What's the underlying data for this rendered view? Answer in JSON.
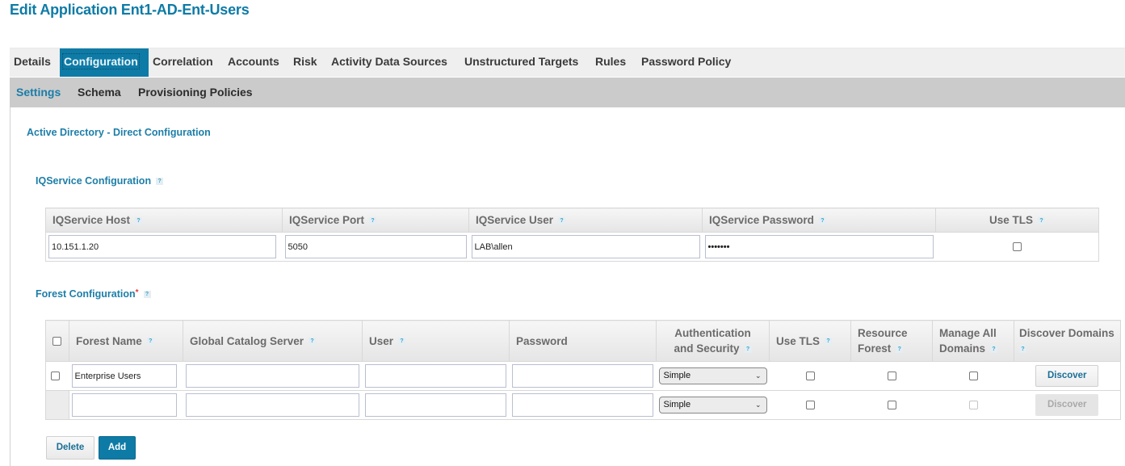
{
  "page": {
    "title": "Edit Application Ent1-AD-Ent-Users"
  },
  "tabs": [
    {
      "label": "Details",
      "active": false
    },
    {
      "label": "Configuration",
      "active": true
    },
    {
      "label": "Correlation",
      "active": false
    },
    {
      "label": "Accounts",
      "active": false
    },
    {
      "label": "Risk",
      "active": false
    },
    {
      "label": "Activity Data Sources",
      "active": false
    },
    {
      "label": "Unstructured Targets",
      "active": false
    },
    {
      "label": "Rules",
      "active": false
    },
    {
      "label": "Password Policy",
      "active": false
    }
  ],
  "subtabs": [
    {
      "label": "Settings",
      "active": true
    },
    {
      "label": "Schema",
      "active": false
    },
    {
      "label": "Provisioning Policies",
      "active": false
    }
  ],
  "section": {
    "title": "Active Directory - Direct Configuration"
  },
  "iqservice": {
    "title": "IQService Configuration",
    "help_icon": "?",
    "columns": [
      "IQService Host",
      "IQService Port",
      "IQService User",
      "IQService Password",
      "Use TLS"
    ],
    "values": {
      "host": "10.151.1.20",
      "port": "5050",
      "user": "LAB\\allen",
      "password": "•••••••",
      "use_tls": false
    }
  },
  "forest": {
    "title": "Forest Configuration",
    "required_mark": "*",
    "help_icon": "?",
    "columns": {
      "forest_name": "Forest Name",
      "gc_server": "Global Catalog Server",
      "user": "User",
      "password": "Password",
      "auth_line1": "Authentication",
      "auth_line2": "and Security",
      "use_tls": "Use TLS",
      "resource_line1": "Resource",
      "resource_line2": "Forest",
      "manage_line1": "Manage All",
      "manage_line2": "Domains",
      "discover": "Discover Domains"
    },
    "rows": [
      {
        "forest_name": "Enterprise Users",
        "gc_server": "",
        "user": "",
        "password": "",
        "auth": "Simple",
        "use_tls": false,
        "resource_forest": false,
        "manage_all_domains": false,
        "discover_label": "Discover",
        "discover_enabled": true
      },
      {
        "forest_name": "",
        "gc_server": "",
        "user": "",
        "password": "",
        "auth": "Simple",
        "use_tls": false,
        "resource_forest": false,
        "manage_all_domains": false,
        "discover_label": "Discover",
        "discover_enabled": false
      }
    ]
  },
  "actions": {
    "delete_label": "Delete",
    "add_label": "Add"
  },
  "colors": {
    "accent": "#0e7ba6",
    "title": "#1d7ea8",
    "tabbar": "#efefef",
    "subbar": "#cbcbcb"
  }
}
